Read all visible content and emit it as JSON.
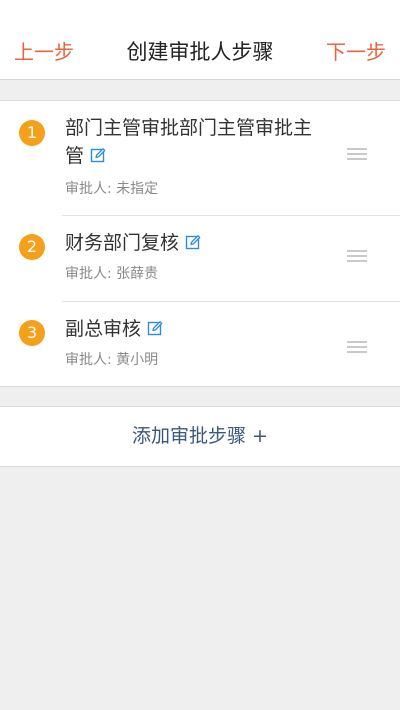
{
  "navbar": {
    "back_label": "上一步",
    "title": "创建审批人步骤",
    "next_label": "下一步"
  },
  "steps": [
    {
      "number": "1",
      "title": "部门主管审批部门主管审批主管",
      "approver": "审批人: 未指定"
    },
    {
      "number": "2",
      "title": "财务部门复核",
      "approver": "审批人: 张薛贵"
    },
    {
      "number": "3",
      "title": "副总审核",
      "approver": "审批人: 黄小明"
    }
  ],
  "add_step": {
    "label": "添加审批步骤",
    "plus": "+"
  },
  "colors": {
    "accent": "#e8643c",
    "badge": "#f5a01a",
    "edit_icon": "#2a8de0",
    "link": "#3c5878"
  },
  "icons": {
    "edit": "edit-icon",
    "drag": "drag-handle-icon"
  }
}
